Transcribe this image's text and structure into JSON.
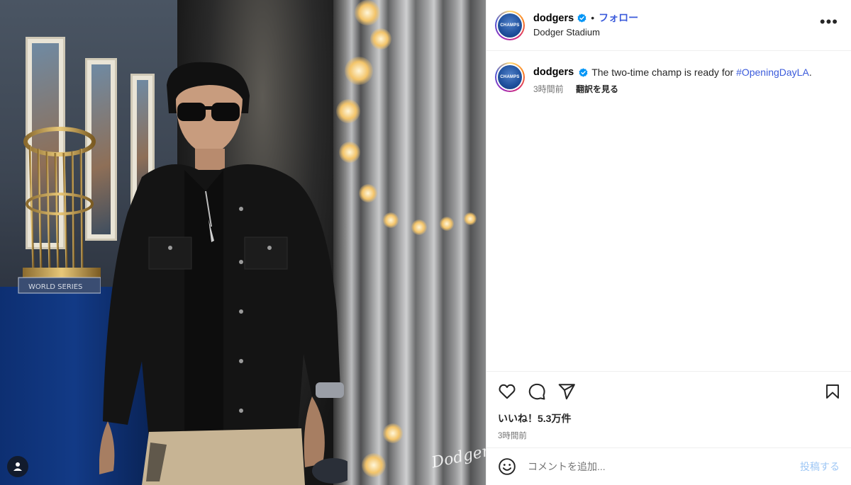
{
  "post": {
    "image_alt": "Player wearing sunglasses and black jacket walking past World Series trophies",
    "watermark": "Dodgers",
    "brand_color": "#0095f6",
    "icons": [
      "user-tag-icon"
    ]
  },
  "header": {
    "username": "dodgers",
    "verified": true,
    "separator": "•",
    "follow_label": "フォロー",
    "location": "Dodger Stadium",
    "more_label": "•••",
    "avatar_text": "CHAMPS"
  },
  "caption": {
    "username": "dodgers",
    "text": "The two-time champ is ready for",
    "hashtag": "#OpeningDayLA",
    "after": ".",
    "time_ago": "3時間前",
    "translate_label": "翻訳を見る"
  },
  "actions": {
    "icons": [
      "heart-icon",
      "comment-icon",
      "share-icon",
      "bookmark-icon"
    ],
    "likes_text": "いいね！5.3万件",
    "timestamp": "3時間前"
  },
  "comment_box": {
    "placeholder": "コメントを追加...",
    "post_label": "投稿する"
  }
}
